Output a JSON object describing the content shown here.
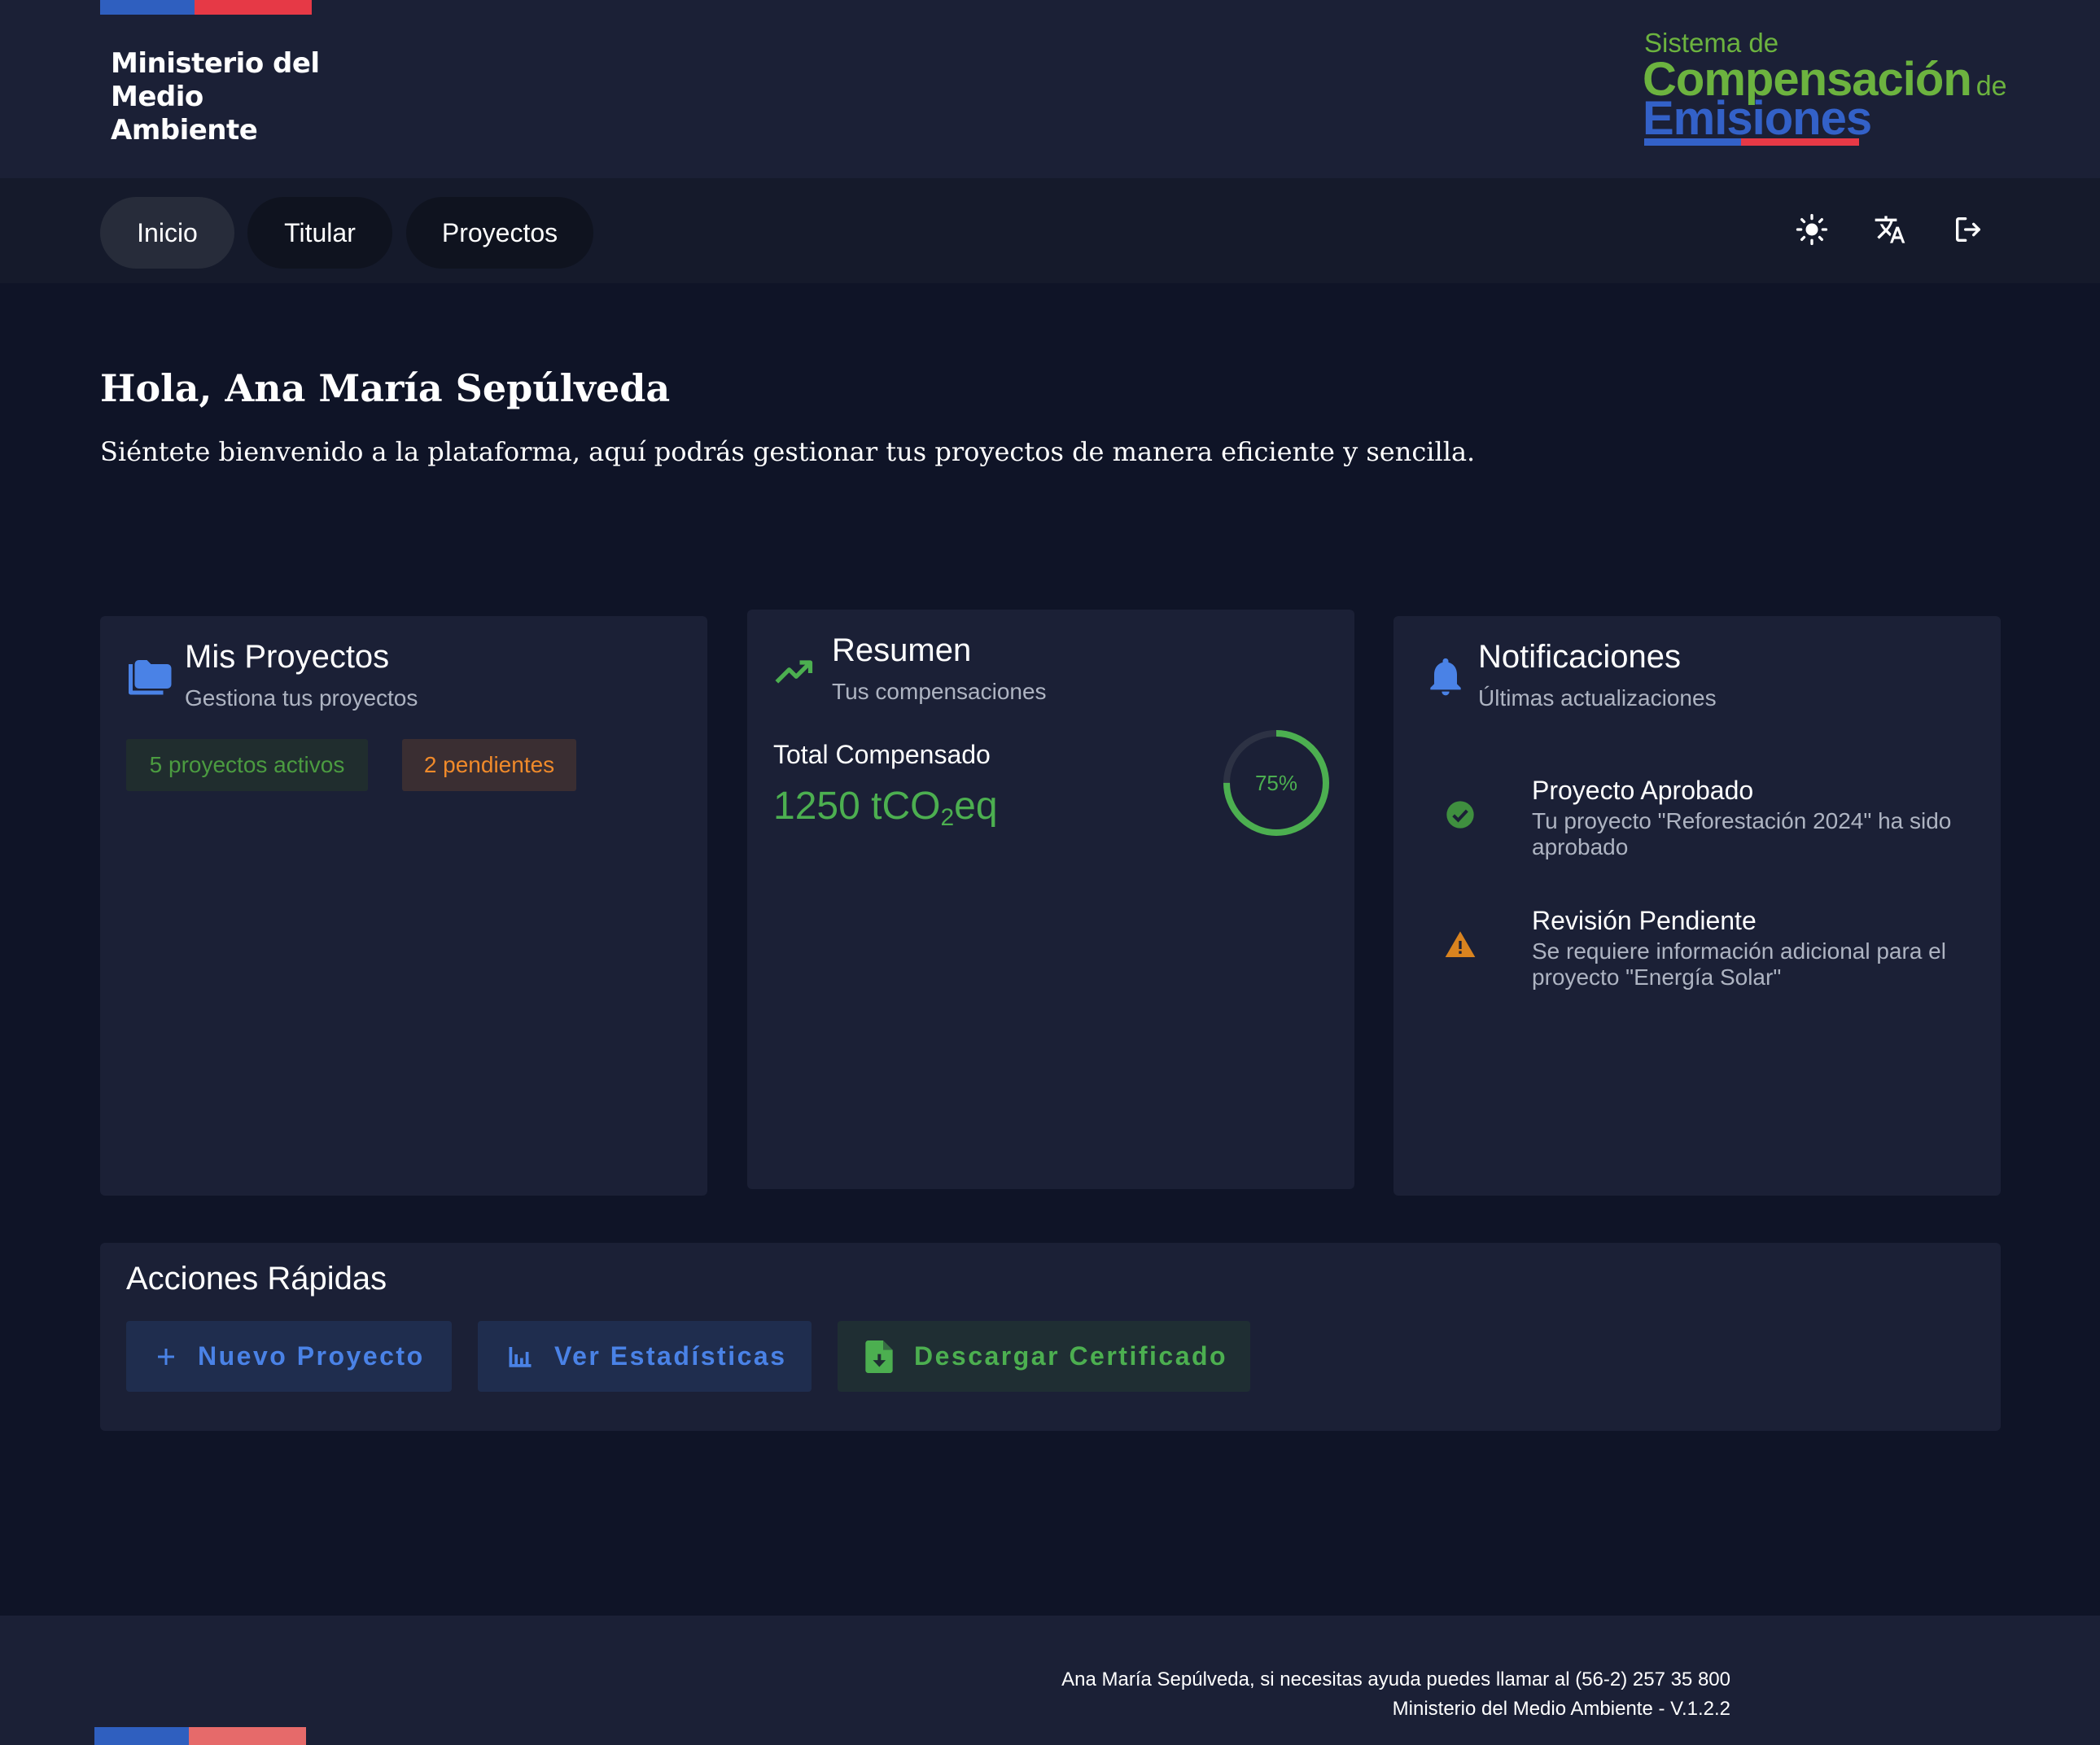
{
  "header": {
    "ministry_lines": [
      "Ministerio del",
      "Medio",
      "Ambiente"
    ],
    "brand": {
      "line1": "Sistema de",
      "line2": "Compensación",
      "line2_suffix": "de",
      "line3": "Emisiones"
    }
  },
  "nav": {
    "tabs": [
      {
        "label": "Inicio",
        "active": true
      },
      {
        "label": "Titular",
        "active": false
      },
      {
        "label": "Proyectos",
        "active": false
      }
    ],
    "icons": [
      "brightness-icon",
      "translate-icon",
      "logout-icon"
    ]
  },
  "greeting": {
    "title": "Hola, Ana María Sepúlveda",
    "subtitle": "Siéntete bienvenido a la plataforma, aquí podrás gestionar tus proyectos de manera eficiente y sencilla."
  },
  "projects_card": {
    "title": "Mis Proyectos",
    "subtitle": "Gestiona tus proyectos",
    "icon": "folder-icon",
    "chips": {
      "active": "5 proyectos activos",
      "pending": "2 pendientes"
    }
  },
  "summary_card": {
    "title": "Resumen",
    "subtitle": "Tus compensaciones",
    "icon": "trending-up-icon",
    "total_label": "Total Compensado",
    "total_value": "1250 tCO",
    "total_sub": "2",
    "total_unit": "eq",
    "progress_percent": 75,
    "progress_label": "75%"
  },
  "notifications_card": {
    "title": "Notificaciones",
    "subtitle": "Últimas actualizaciones",
    "icon": "bell-icon",
    "items": [
      {
        "icon": "check-circle-icon",
        "title": "Proyecto Aprobado",
        "body": "Tu proyecto \"Reforestación 2024\" ha sido aprobado"
      },
      {
        "icon": "warning-icon",
        "title": "Revisión Pendiente",
        "body": "Se requiere información adicional para el proyecto \"Energía Solar\""
      }
    ]
  },
  "quick_actions": {
    "title": "Acciones Rápidas",
    "buttons": [
      {
        "label": "Nuevo Proyecto",
        "icon": "plus-icon"
      },
      {
        "label": "Ver Estadísticas",
        "icon": "bar-chart-icon"
      },
      {
        "label": "Descargar Certificado",
        "icon": "file-download-icon"
      }
    ]
  },
  "footer": {
    "help_text": "Ana María Sepúlveda, si necesitas ayuda puedes llamar al (56-2) 257 35 800",
    "version_text": "Ministerio del Medio Ambiente - V.1.2.2"
  },
  "colors": {
    "background": "#0f1427",
    "card": "#1b2036",
    "accent_green": "#4caf50",
    "accent_blue": "#4a82e6",
    "accent_orange": "#f08a2a",
    "flag_blue": "#2f5fbf",
    "flag_red": "#e63946"
  }
}
